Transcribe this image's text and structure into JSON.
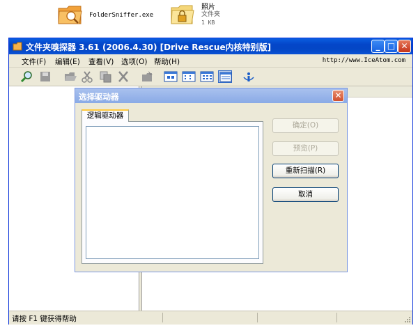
{
  "desktop": {
    "items": [
      {
        "label": "FolderSniffer.exe",
        "icon": "folder-sniffer-icon"
      },
      {
        "name": "照片",
        "type": "文件夹",
        "size": "1 KB",
        "icon": "folder-lock-icon"
      }
    ]
  },
  "window": {
    "title": "文件夹嗅探器 3.61 (2006.4.30) [Drive Rescue内核特别版]",
    "controls": {
      "minimize": "_",
      "maximize": "□",
      "close": "✕"
    },
    "menu": [
      {
        "label": "文件(F)"
      },
      {
        "label": "编辑(E)"
      },
      {
        "label": "查看(V)"
      },
      {
        "label": "选项(O)"
      },
      {
        "label": "帮助(H)"
      }
    ],
    "menu_url": "http://www.IceAtom.com",
    "toolbar_icons": [
      "search-icon",
      "save-icon",
      "open-folder-icon",
      "cut-icon",
      "copy-icon",
      "delete-icon",
      "paste-icon",
      "large-icons-view-icon",
      "small-icons-view-icon",
      "list-view-icon",
      "details-view-icon",
      "about-icon"
    ],
    "status_text": "请按 F1 键获得帮助"
  },
  "dialog": {
    "title": "选择驱动器",
    "tab_label": "逻辑驱动器",
    "buttons": {
      "ok": "确定(O)",
      "preview": "预览(P)",
      "rescan": "重新扫描(R)",
      "cancel": "取消"
    }
  },
  "colors": {
    "titlebar": "#0a5ee0",
    "dialog_title": "#8aaae6",
    "window_bg": "#ece9d8",
    "tab_accent": "#ffc83c"
  }
}
